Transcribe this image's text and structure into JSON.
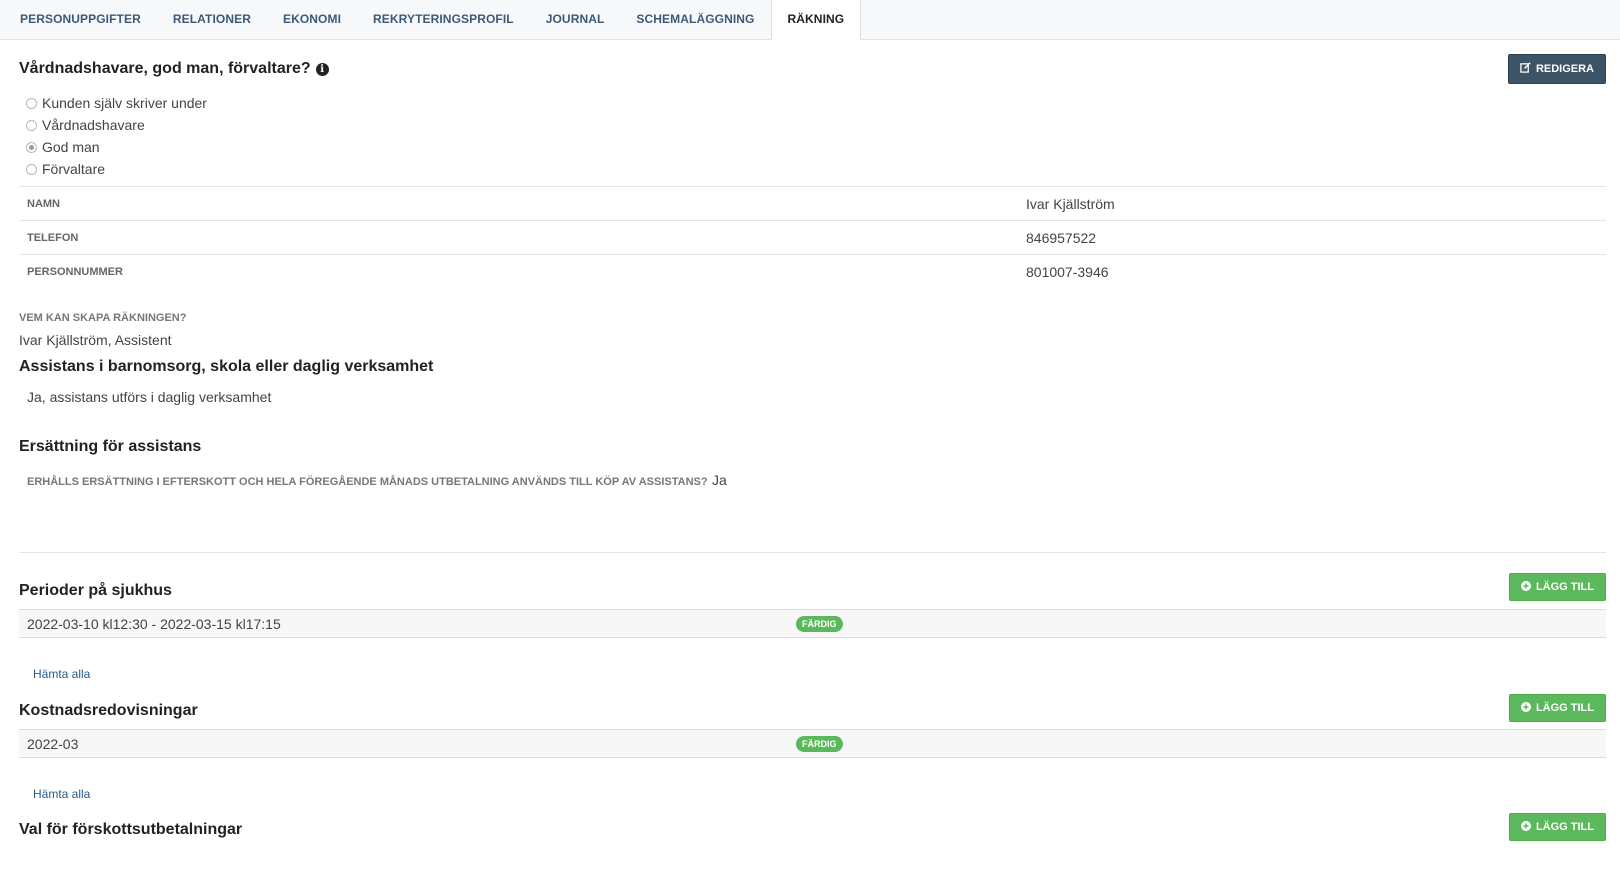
{
  "tabs": [
    {
      "label": "PERSONUPPGIFTER"
    },
    {
      "label": "RELATIONER"
    },
    {
      "label": "EKONOMI"
    },
    {
      "label": "REKRYTERINGSPROFIL"
    },
    {
      "label": "JOURNAL"
    },
    {
      "label": "SCHEMALÄGGNING"
    },
    {
      "label": "RÄKNING",
      "active": true
    }
  ],
  "guardian": {
    "title": "Vårdnadshavare, god man, förvaltare?",
    "edit_label": "REDIGERA",
    "options": [
      {
        "label": "Kunden själv skriver under",
        "checked": false
      },
      {
        "label": "Vårdnadshavare",
        "checked": false
      },
      {
        "label": "God man",
        "checked": true
      },
      {
        "label": "Förvaltare",
        "checked": false
      }
    ],
    "rows": [
      {
        "label": "NAMN",
        "value": "Ivar Kjällström"
      },
      {
        "label": "TELEFON",
        "value": "846957522"
      },
      {
        "label": "PERSONNUMMER",
        "value": "801007-3946"
      }
    ]
  },
  "invoice_creator": {
    "label": "VEM KAN SKAPA RÄKNINGEN?",
    "value": "Ivar Kjällström, Assistent"
  },
  "assistance": {
    "title": "Assistans i barnomsorg, skola eller daglig verksamhet",
    "value": "Ja, assistans utförs i daglig verksamhet"
  },
  "compensation": {
    "title": "Ersättning för assistans",
    "question": "ERHÅLLS ERSÄTTNING I EFTERSKOTT OCH HELA FÖREGÅENDE MÅNADS UTBETALNING ANVÄNDS TILL KÖP AV ASSISTANS?",
    "answer": "Ja"
  },
  "hospital": {
    "title": "Perioder på sjukhus",
    "add_label": "LÄGG TILL",
    "rows": [
      {
        "period": "2022-03-10 kl12:30 - 2022-03-15 kl17:15",
        "status": "FÄRDIG"
      }
    ],
    "fetch_all": "Hämta alla"
  },
  "costs": {
    "title": "Kostnadsredovisningar",
    "add_label": "LÄGG TILL",
    "rows": [
      {
        "period": "2022-03",
        "status": "FÄRDIG"
      }
    ],
    "fetch_all": "Hämta alla"
  },
  "advance": {
    "title": "Val för förskottsutbetalningar",
    "add_label": "LÄGG TILL"
  },
  "colors": {
    "accent_dark": "#3d5366",
    "success": "#5cb85c",
    "link": "#2b5a88"
  }
}
